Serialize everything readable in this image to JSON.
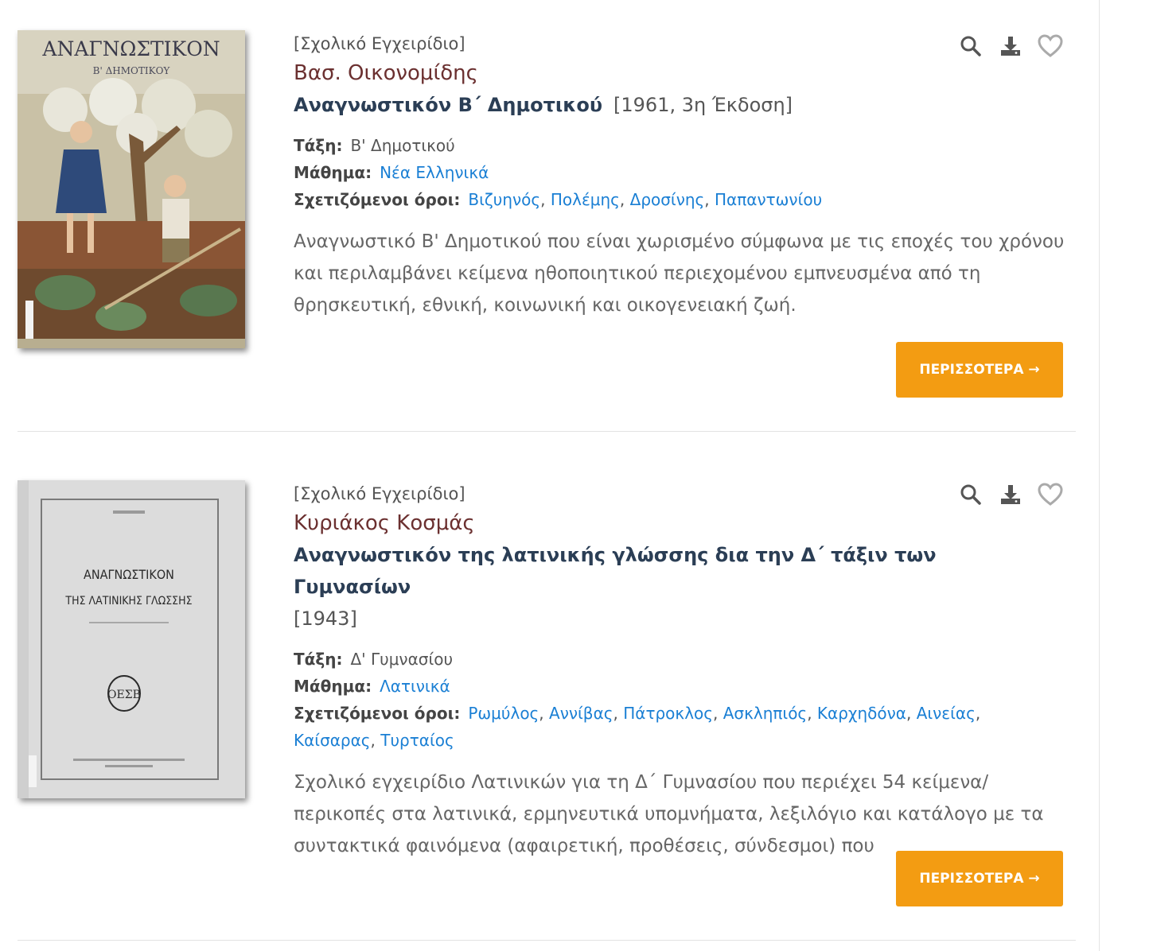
{
  "entries": [
    {
      "type": "[Σχολικό Εγχειρίδιο]",
      "author": "Βασ. Οικονομίδης",
      "title": "Αναγνωστικόν Β΄ Δημοτικού",
      "year": "[1961, 3η Έκδοση]",
      "class_label": "Τάξη:",
      "class_value": "Β' Δημοτικού",
      "subject_label": "Μάθημα:",
      "subject_value": "Νέα Ελληνικά",
      "terms_label": "Σχετιζόμενοι όροι:",
      "terms": [
        "Βιζυηνός",
        "Πολέμης",
        "Δροσίνης",
        "Παπαντωνίου"
      ],
      "description": "Αναγνωστικό Β' Δημοτικού που είναι χωρισμένο σύμφωνα με τις εποχές του χρόνου και περιλαμβάνει κείμενα ηθοποιητικού περιεχομένου εμπνευσμένα από τη θρησκευτική, εθνική, κοινωνική και οικογενειακή ζωή.",
      "more_label": "ΠΕΡΙΣΣΟΤΕΡΑ →",
      "cover": {
        "title_line1": "ΑΝΑΓΝΩΣΤΙΚΟΝ",
        "title_line2": "Β' ΔΗΜΟΤΙΚΟΥ"
      }
    },
    {
      "type": "[Σχολικό Εγχειρίδιο]",
      "author": "Κυριάκος Κοσμάς",
      "title": "Αναγνωστικόν της λατινικής γλώσσης δια την Δ΄ τάξιν των Γυμνασίων",
      "year": "[1943]",
      "class_label": "Τάξη:",
      "class_value": "Δ' Γυμνασίου",
      "subject_label": "Μάθημα:",
      "subject_value": "Λατινικά",
      "terms_label": "Σχετιζόμενοι όροι:",
      "terms": [
        "Ρωμύλος",
        "Αννίβας",
        "Πάτροκλος",
        "Ασκληπιός",
        "Καρχηδόνα",
        "Αινείας",
        "Καίσαρας",
        "Τυρταίος"
      ],
      "description": "Σχολικό εγχειρίδιο Λατινικών για τη Δ΄ Γυμνασίου που περιέχει 54 κείμενα/περικοπές στα λατινικά, ερμηνευτικά υπομνήματα, λεξιλόγιο και κατάλογο με τα συντακτικά φαινόμενα (αφαιρετική, προθέσεις, σύνδεσμοι) που",
      "more_label": "ΠΕΡΙΣΣΟΤΕΡΑ →",
      "cover": {
        "title_line1": "ΑΝΑΓΝΩΣΤΙΚΟΝ",
        "title_line2": "ΤΗΣ ΛΑΤΙΝΙΚΗΣ ΓΛΩΣΣΗΣ",
        "emblem": "ΟΕΣΒ"
      }
    }
  ],
  "icons": [
    "search-icon",
    "download-icon",
    "heart-icon"
  ],
  "colors": {
    "accent": "#f39c12",
    "link": "#1a7fd4",
    "title": "#2b3e55",
    "author": "#6b3030"
  }
}
